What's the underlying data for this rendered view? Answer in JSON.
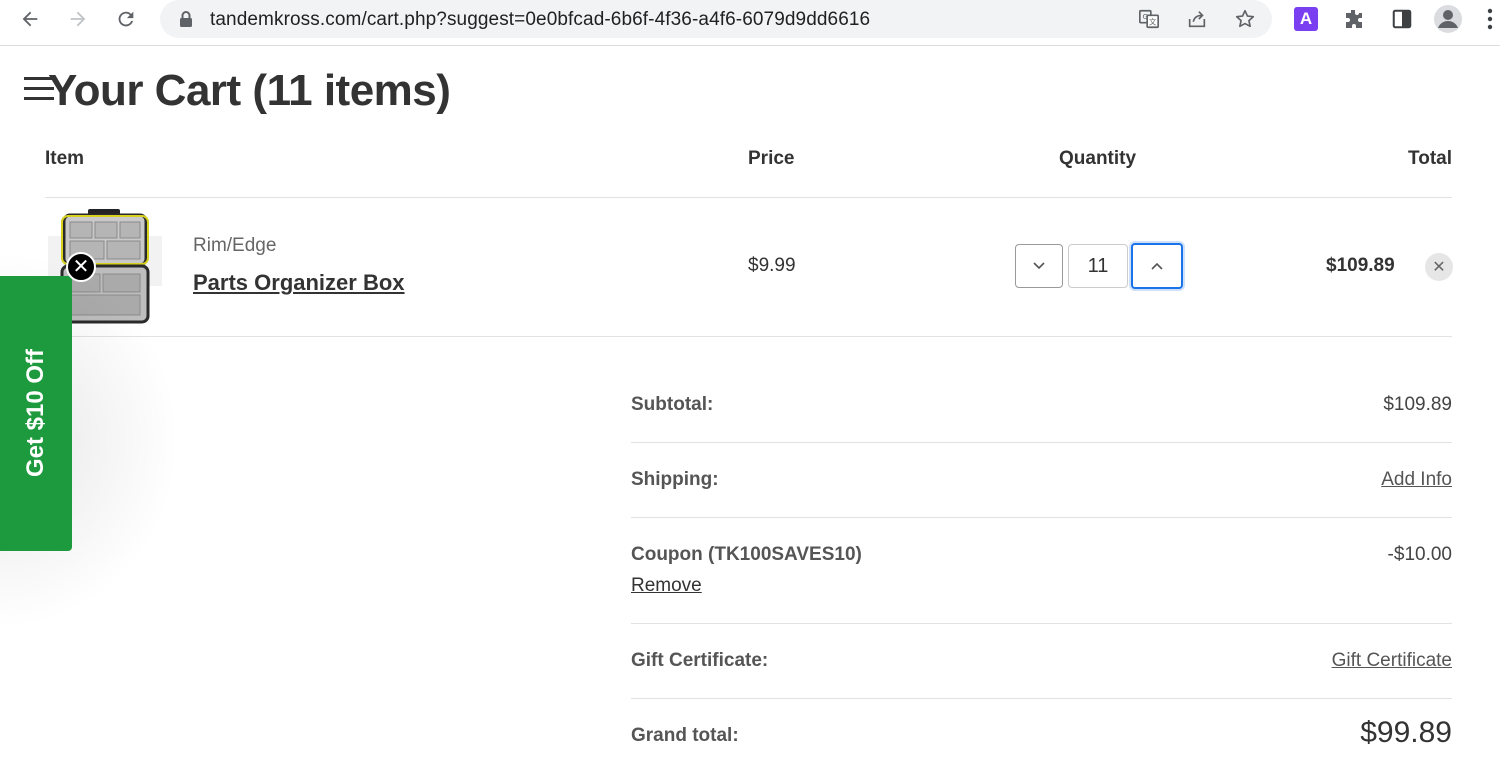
{
  "browser": {
    "url": "tandemkross.com/cart.php?suggest=0e0bfcad-6b6f-4f36-a4f6-6079d9dd6616",
    "extension_badge": "A"
  },
  "page": {
    "title": "Your Cart (11 items)"
  },
  "table": {
    "headers": {
      "item": "Item",
      "price": "Price",
      "quantity": "Quantity",
      "total": "Total"
    },
    "items": [
      {
        "brand": "Rim/Edge",
        "name": "Parts Organizer Box",
        "price": "$9.99",
        "quantity": "11",
        "total": "$109.89"
      }
    ]
  },
  "promo": {
    "label": "Get $10 Off",
    "color": "#1e9a3e"
  },
  "summary": {
    "subtotal_label": "Subtotal:",
    "subtotal_value": "$109.89",
    "shipping_label": "Shipping:",
    "shipping_value": "Add Info",
    "coupon_label": "Coupon (TK100SAVES10)",
    "coupon_value": "-$10.00",
    "coupon_remove": "Remove",
    "gift_label": "Gift Certificate:",
    "gift_value": "Gift Certificate",
    "grand_label": "Grand total:",
    "grand_value": "$99.89"
  },
  "icons": {
    "back": "arrow-left-icon",
    "forward": "arrow-right-icon",
    "reload": "reload-icon",
    "lock": "lock-icon",
    "translate": "translate-icon",
    "share": "share-icon",
    "bookmark": "star-icon",
    "extensions": "puzzle-icon",
    "side_panel": "side-panel-icon",
    "profile": "profile-icon",
    "menu": "kebab-menu-icon",
    "qty_decrease": "chevron-down-icon",
    "qty_increase": "chevron-up-icon",
    "remove_item": "close-icon"
  },
  "colors": {
    "focus_ring": "#1a73e8",
    "extension_badge_bg": "#7b3ff2"
  }
}
